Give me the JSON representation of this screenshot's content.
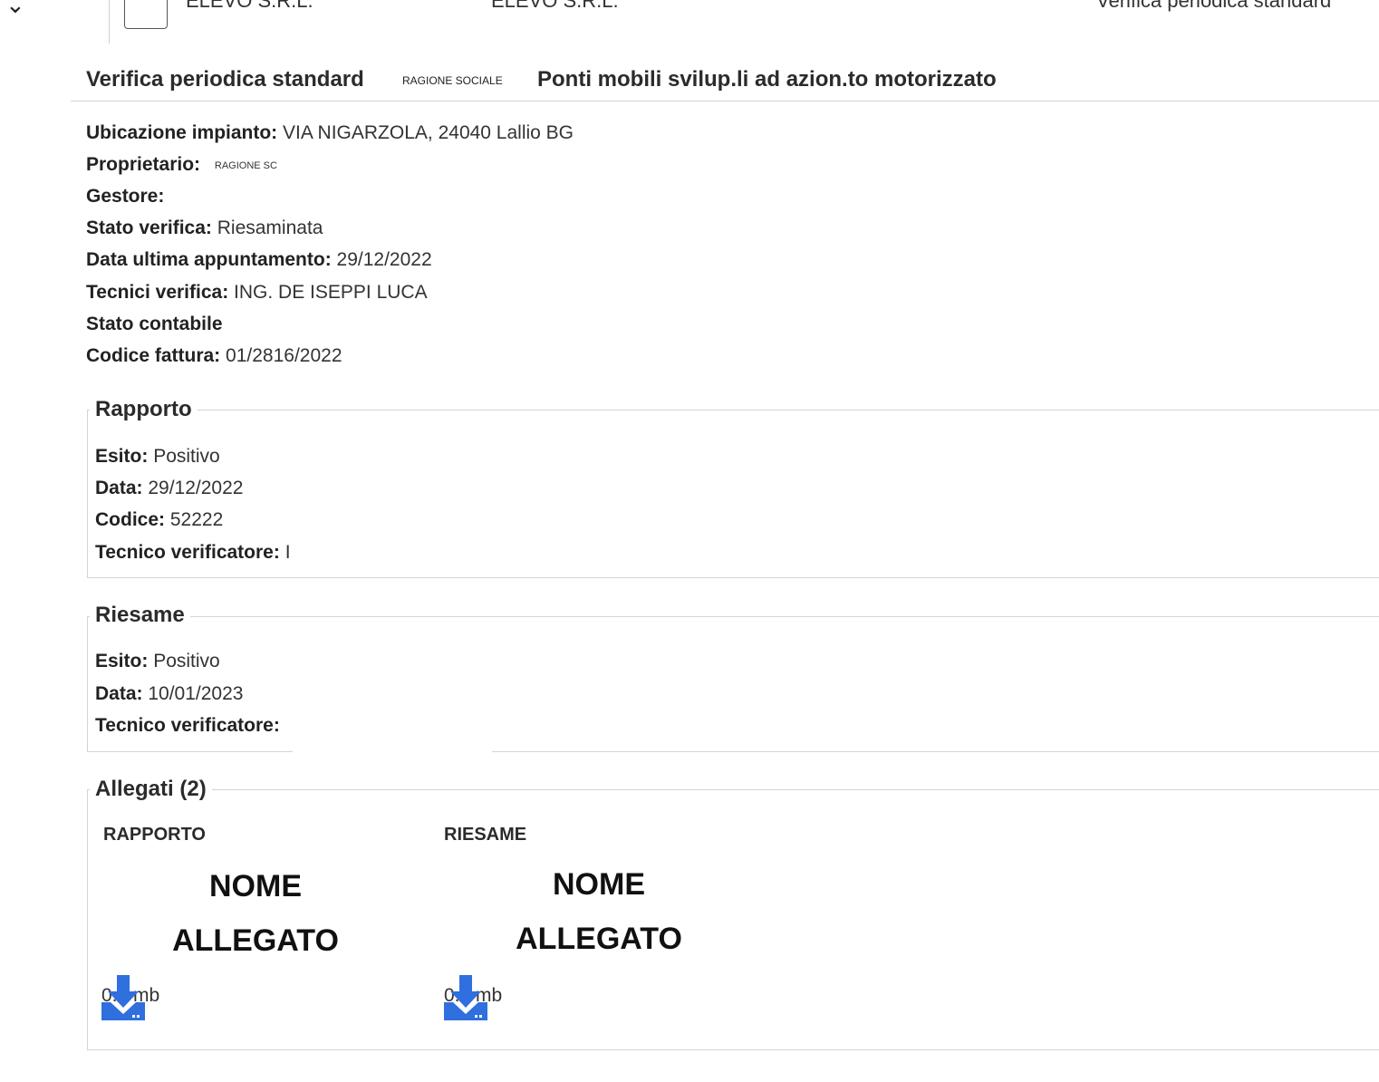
{
  "top_row": {
    "col1": "ELEVO S.R.L.",
    "col2": "ELEVO S.R.L.",
    "col3": "Verifica periodica standard"
  },
  "header": {
    "title": "Verifica periodica standard",
    "small_label": "RAGIONE SOCIALE",
    "subtitle": "Ponti mobili svilup.li ad azion.to motorizzato"
  },
  "info": {
    "ubicazione_label": "Ubicazione impianto:",
    "ubicazione_value": "VIA NIGARZOLA, 24040 Lallio BG",
    "proprietario_label": "Proprietario:",
    "proprietario_value": "RAGIONE SC",
    "gestore_label": "Gestore:",
    "stato_verifica_label": "Stato verifica:",
    "stato_verifica_value": "Riesaminata",
    "data_appuntamento_label": "Data ultima appuntamento:",
    "data_appuntamento_value": "29/12/2022",
    "tecnici_label": "Tecnici verifica:",
    "tecnici_value": "ING. DE ISEPPI LUCA",
    "stato_contabile_label": "Stato contabile",
    "codice_fattura_label": "Codice fattura:",
    "codice_fattura_value": "01/2816/2022"
  },
  "rapporto": {
    "legend": "Rapporto",
    "esito_label": "Esito:",
    "esito_value": "Positivo",
    "data_label": "Data:",
    "data_value": "29/12/2022",
    "codice_label": "Codice:",
    "codice_value": "52222",
    "tecnico_label": "Tecnico verificatore:",
    "tecnico_value": "I"
  },
  "riesame": {
    "legend": "Riesame",
    "esito_label": "Esito:",
    "esito_value": "Positivo",
    "data_label": "Data:",
    "data_value": "10/01/2023",
    "tecnico_label": "Tecnico verificatore:"
  },
  "allegati": {
    "legend": "Allegati (2)",
    "items": [
      {
        "heading": "RAPPORTO",
        "name_line1": "NOME",
        "name_line2": "ALLEGATO",
        "size": "0.5 mb",
        "icon": "download-icon"
      },
      {
        "heading": "RIESAME",
        "name_line1": "NOME",
        "name_line2": "ALLEGATO",
        "size": "0.5 mb",
        "icon": "download-icon"
      }
    ]
  },
  "colors": {
    "icon_blue": "#2f6fde",
    "border": "#d4d4d4"
  }
}
